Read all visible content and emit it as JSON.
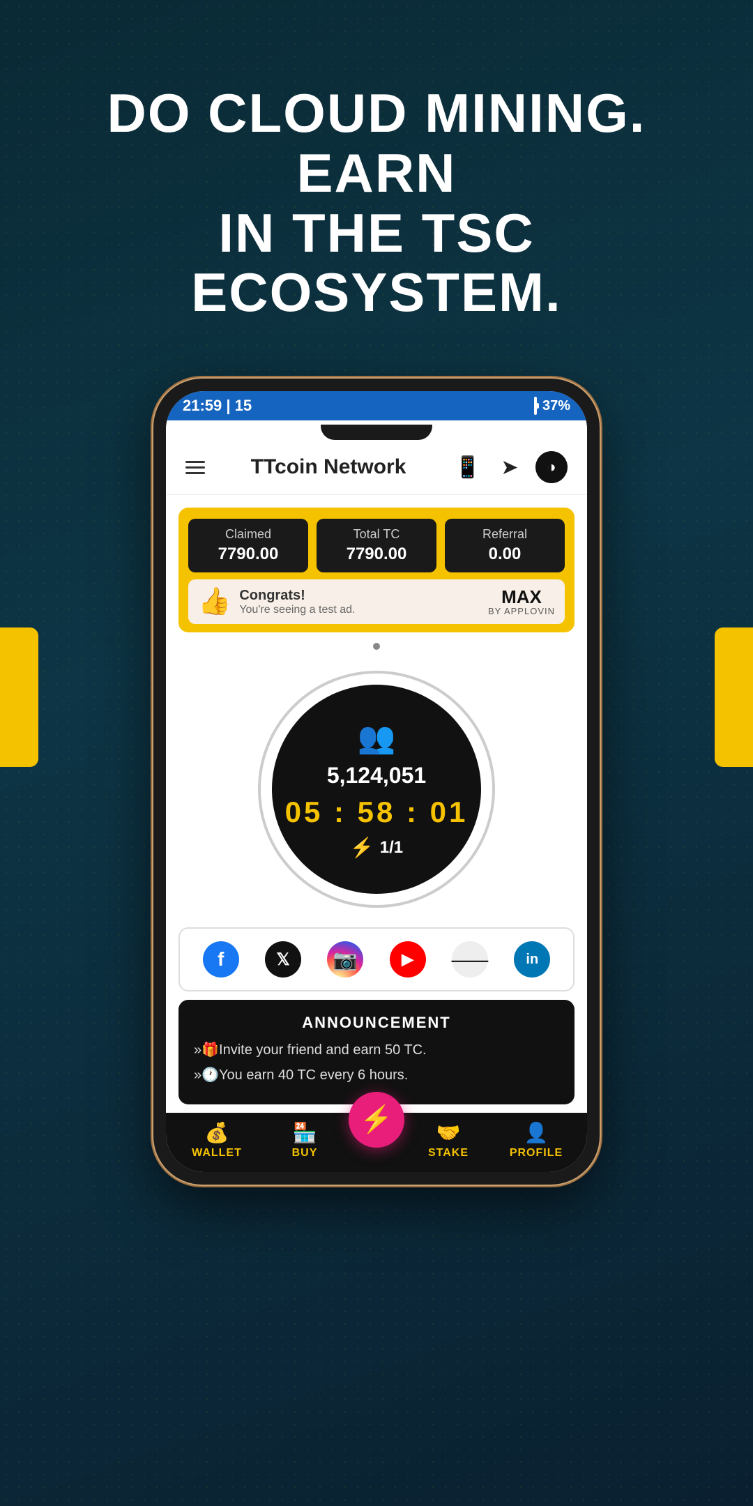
{
  "hero": {
    "line1": "DO CLOUD MINING. EARN",
    "line2": "IN THE TSC ECOSYSTEM."
  },
  "status_bar": {
    "time": "21:59 | 15",
    "battery_percent": "37%"
  },
  "header": {
    "title": "TTcoin Network",
    "menu_label": "Menu"
  },
  "stats": {
    "claimed_label": "Claimed",
    "claimed_value": "7790.00",
    "total_tc_label": "Total TC",
    "total_tc_value": "7790.00",
    "referral_label": "Referral",
    "referral_value": "0.00"
  },
  "ad_banner": {
    "congrats": "Congrats!",
    "subtitle": "You're seeing a test ad.",
    "brand": "MAX",
    "brand_sub": "BY APPLOVIN"
  },
  "mining": {
    "user_count": "5,124,051",
    "timer": "05 : 58 : 01",
    "boost": "1/1"
  },
  "social": {
    "platforms": [
      "facebook",
      "x",
      "instagram",
      "youtube",
      "medium",
      "linkedin"
    ]
  },
  "announcement": {
    "title": "ANNOUNCEMENT",
    "items": [
      "»🎁Invite your friend and earn 50 TC.",
      "»🕐You earn 40 TC every 6 hours."
    ]
  },
  "bottom_nav": {
    "items": [
      {
        "label": "WALLET",
        "icon": "💰"
      },
      {
        "label": "BUY",
        "icon": "🏪"
      },
      {
        "label": "",
        "icon": "⚡"
      },
      {
        "label": "STAKE",
        "icon": "🤝"
      },
      {
        "label": "PROFILE",
        "icon": "👤"
      }
    ]
  }
}
